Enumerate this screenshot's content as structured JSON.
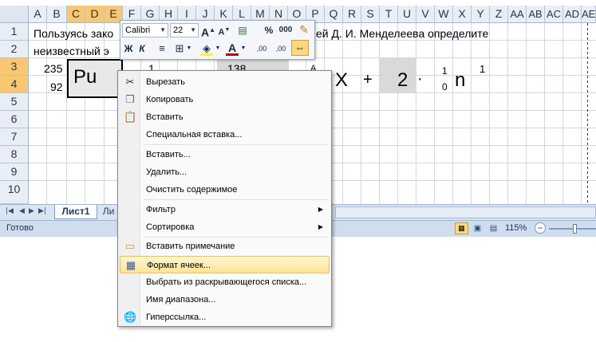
{
  "sheet": {
    "columns": [
      "A",
      "B",
      "C",
      "D",
      "E",
      "F",
      "G",
      "H",
      "I",
      "J",
      "K",
      "L",
      "M",
      "N",
      "O",
      "P",
      "Q",
      "R",
      "S",
      "T",
      "U",
      "V",
      "W",
      "X",
      "Y",
      "Z",
      "AA",
      "AB",
      "AC",
      "AD",
      "AE"
    ],
    "rows": [
      "1",
      "2",
      "3",
      "4",
      "5",
      "6",
      "7",
      "8",
      "9",
      "10"
    ],
    "r1_text": "Пользуясь зако",
    "r1_text_right": "ей Д. И. Менделеева определите",
    "r2_text": "неизвестный э",
    "mass_number": "235",
    "atomic_number": "92",
    "element": "Pu",
    "f3": "1",
    "k3": "138",
    "p3": "A",
    "x_symbol": "X",
    "plus": "+",
    "coef": "2",
    "dot": "·",
    "n_top": "1",
    "n_bottom": "0",
    "n_symbol": "n",
    "sup_right": "1"
  },
  "mini_toolbar": {
    "font_name": "Calibri",
    "font_size": "22",
    "bold": "Ж",
    "italic": "К",
    "percent": "%",
    "thousands": "000",
    "inc_decimal": ",00",
    "dec_decimal": ",00"
  },
  "tabs": {
    "sheet1": "Лист1",
    "sheet2": "Ли"
  },
  "status": {
    "ready": "Готово",
    "zoom": "115%"
  },
  "context_menu": {
    "items": [
      {
        "label": "Вырезать"
      },
      {
        "label": "Копировать"
      },
      {
        "label": "Вставить"
      },
      {
        "label": "Специальная вставка..."
      },
      {
        "label": "Вставить..."
      },
      {
        "label": "Удалить..."
      },
      {
        "label": "Очистить содержимое"
      },
      {
        "label": "Фильтр"
      },
      {
        "label": "Сортировка"
      },
      {
        "label": "Вставить примечание"
      },
      {
        "label": "Формат ячеек..."
      },
      {
        "label": "Выбрать из раскрывающегося списка..."
      },
      {
        "label": "Имя диапазона..."
      },
      {
        "label": "Гиперссылка..."
      }
    ]
  },
  "colors": {
    "header_bg": "#e9eef6",
    "header_selected": "#f7c771",
    "highlight": "#ffe394",
    "grid": "#d0d7e5"
  }
}
